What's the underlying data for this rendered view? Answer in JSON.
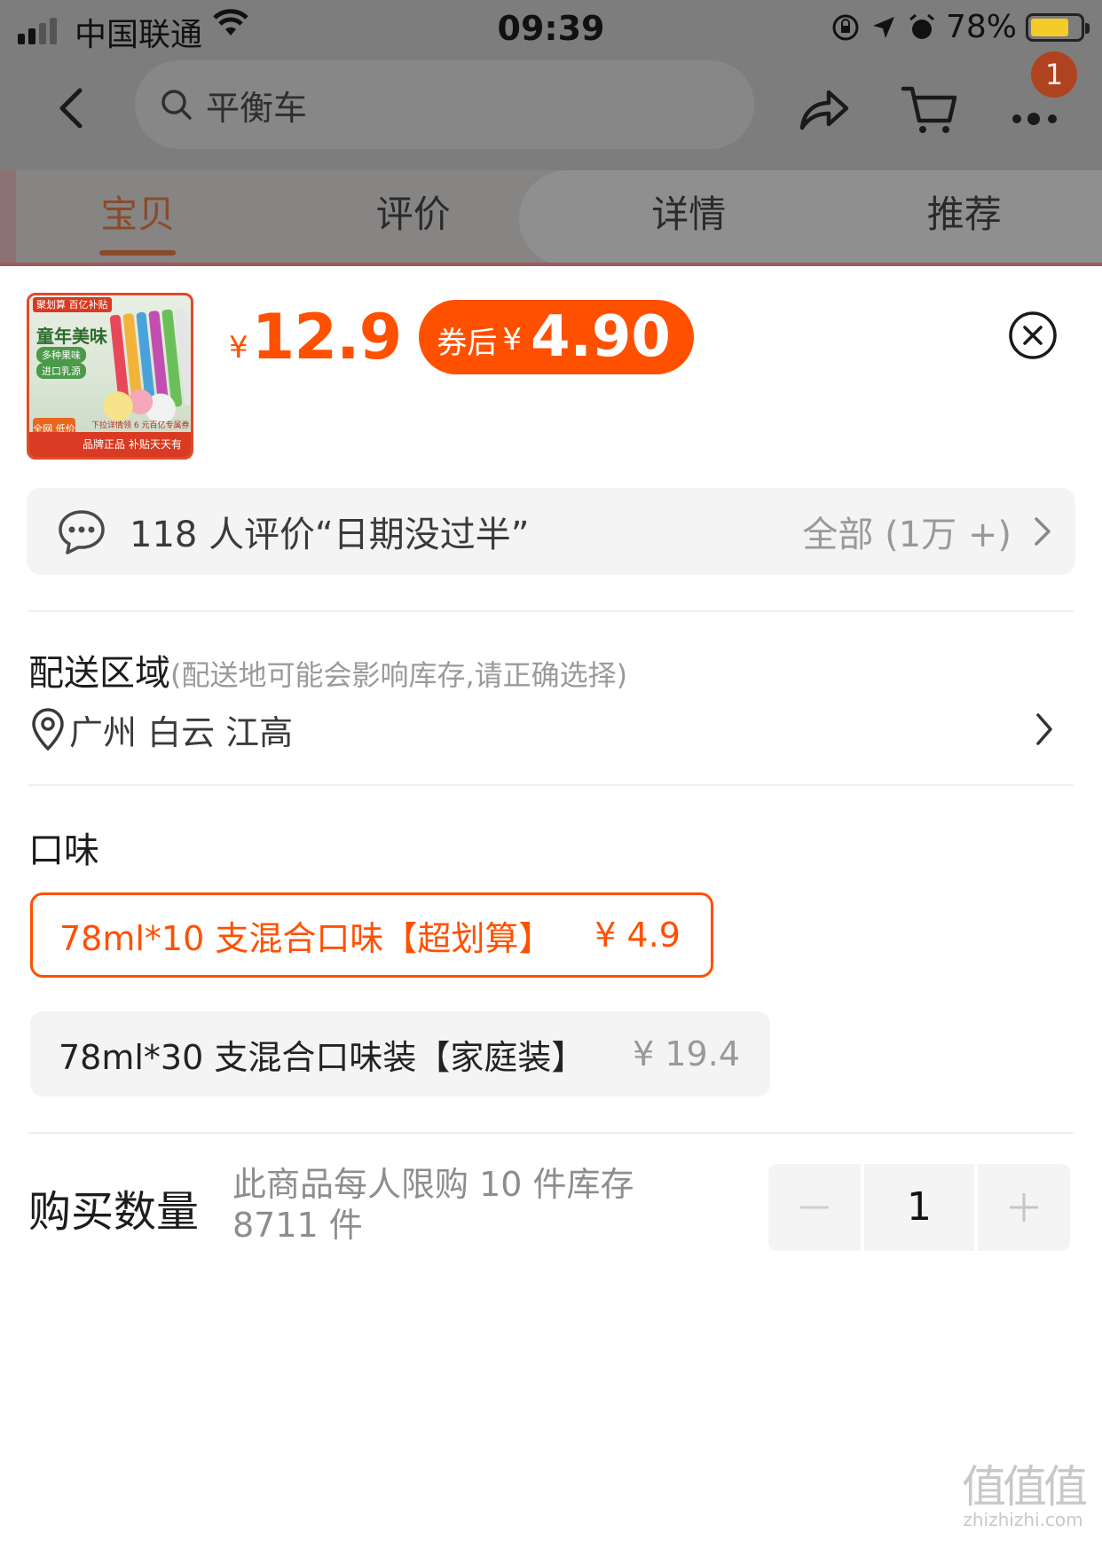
{
  "status_bar": {
    "carrier": "中国联通",
    "time": "09:39",
    "battery_percent": "78%"
  },
  "nav": {
    "search_placeholder": "平衡车",
    "cart_badge": "1"
  },
  "tabs": [
    {
      "label": "宝贝",
      "active": true
    },
    {
      "label": "评价",
      "active": false
    },
    {
      "label": "详情",
      "active": false
    },
    {
      "label": "推荐",
      "active": false
    }
  ],
  "product": {
    "thumb": {
      "brand": "聚划算 百亿补贴",
      "title": "童年美味",
      "tag1": "多种果味",
      "tag2": "进口乳源",
      "corner": "全网 低价",
      "note": "下拉详情领 6 元百亿专属券",
      "footer": "品牌正品 补贴天天有"
    },
    "price_symbol": "¥",
    "price": "12.9",
    "coupon_label": "券后",
    "coupon_symbol": "¥",
    "coupon_price": "4.90"
  },
  "review": {
    "text": "118 人评价“日期没过半”",
    "all_label": "全部 (1万 +)"
  },
  "delivery": {
    "title": "配送区域",
    "hint": "(配送地可能会影响库存,请正确选择)",
    "address": "广州 白云 江高"
  },
  "flavor": {
    "title": "口味",
    "options": [
      {
        "label": "78ml*10 支混合口味【超划算】",
        "price": "¥ 4.9",
        "selected": true
      },
      {
        "label": "78ml*30 支混合口味装【家庭装】",
        "price": "¥ 19.4",
        "selected": false
      }
    ]
  },
  "quantity": {
    "title": "购买数量",
    "note": "此商品每人限购 10 件库存 8711 件",
    "value": "1"
  },
  "watermark": {
    "mark": "值值值",
    "url": "zhizhizhi.com"
  },
  "colors": {
    "accent": "#ff5000",
    "overlay": "#7d7d7d",
    "muted": "#999999"
  }
}
